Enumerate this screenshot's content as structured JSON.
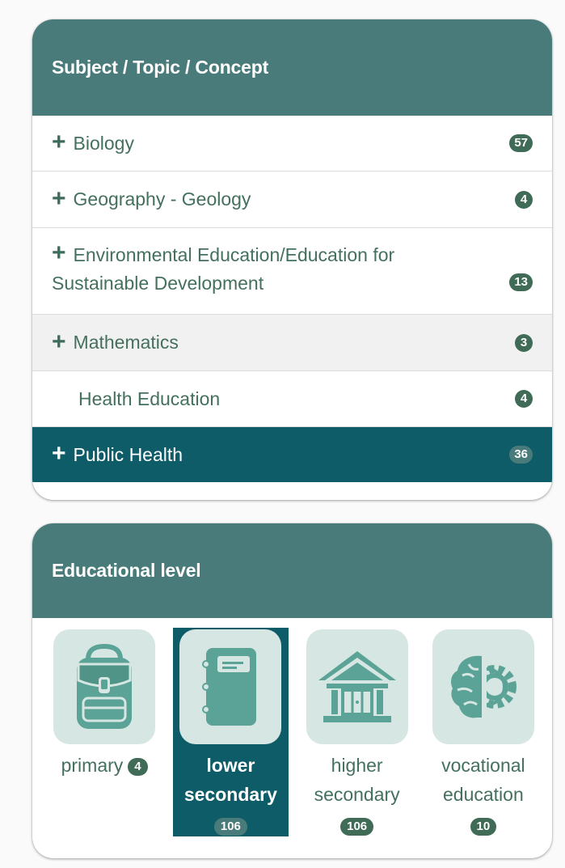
{
  "subject_panel": {
    "title": "Subject / Topic / Concept",
    "items": [
      {
        "label": "Biology",
        "count": "57",
        "expandable": true
      },
      {
        "label": "Geography - Geology",
        "count": "4",
        "expandable": true
      },
      {
        "label_line1": "Environmental Education/Education for",
        "label_line2": "Sustainable Development",
        "count": "13",
        "expandable": true
      },
      {
        "label": "Mathematics",
        "count": "3",
        "expandable": true
      },
      {
        "label": "Health Education",
        "count": "4",
        "expandable": false
      },
      {
        "label": "Public Health",
        "count": "36",
        "expandable": true,
        "active": true
      }
    ]
  },
  "level_panel": {
    "title": "Educational level",
    "levels": [
      {
        "label": "primary",
        "count": "4",
        "icon": "backpack-icon"
      },
      {
        "label_line1": "lower",
        "label_line2": "secondary",
        "count": "106",
        "icon": "notebook-icon",
        "selected": true
      },
      {
        "label_line1": "higher",
        "label_line2": "secondary",
        "count": "106",
        "icon": "university-building-icon"
      },
      {
        "label_line1": "vocational",
        "label_line2": "education",
        "count": "10",
        "icon": "brain-gear-icon"
      }
    ]
  },
  "colors": {
    "header_bg": "#4a7b7b",
    "active_bg": "#0e5c68",
    "badge_bg": "#3f6b57",
    "text": "#44705e",
    "icon_tile": "#d6e6e2",
    "icon_fill": "#5ba396"
  }
}
